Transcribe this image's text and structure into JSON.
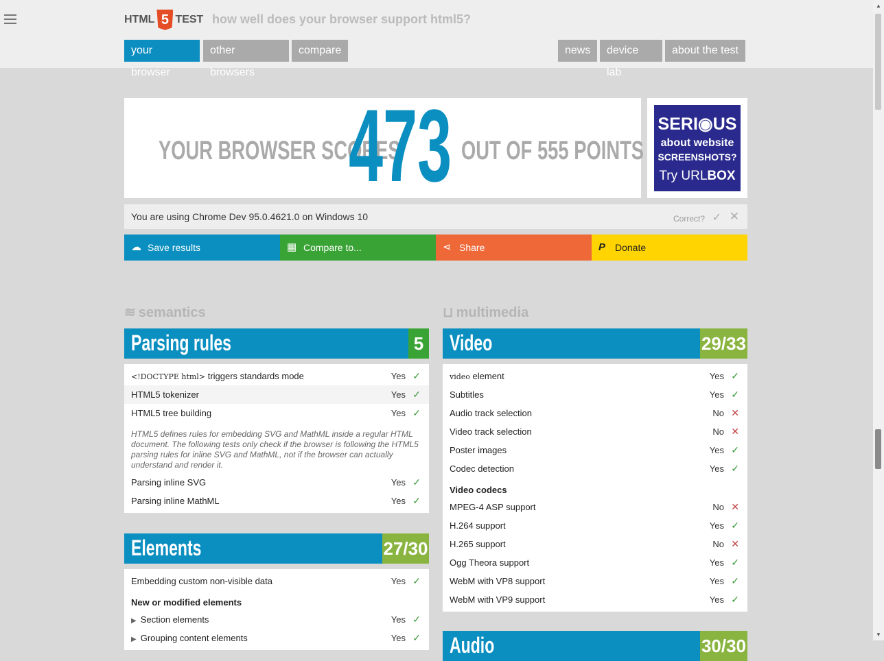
{
  "header": {
    "logo_left": "HTML",
    "logo_shield": "5",
    "logo_right": "TEST",
    "tagline": "how well does your browser support html5?",
    "nav_left": [
      "your browser",
      "other browsers",
      "compare"
    ],
    "nav_right": [
      "news",
      "device lab",
      "about the test"
    ]
  },
  "score": {
    "prefix": "YOUR BROWSER SCORES",
    "value": "473",
    "suffix": "OUT OF 555 POINTS"
  },
  "ad": {
    "line1": "SERI◉US",
    "line2": "about website",
    "line3": "SCREENSHOTS?",
    "line4_a": "Try URL",
    "line4_b": "BOX"
  },
  "browser_info": {
    "text": "You are using Chrome Dev 95.0.4621.0 on Windows 10",
    "correct_label": "Correct?"
  },
  "actions": {
    "save": "Save results",
    "compare": "Compare to...",
    "share": "Share",
    "donate": "Donate"
  },
  "sections": {
    "semantics": "semantics",
    "multimedia": "multimedia"
  },
  "parsing": {
    "title": "Parsing rules",
    "score": "5",
    "row1_code": "<!DOCTYPE html>",
    "row1_text": " triggers standards mode",
    "row2": "HTML5 tokenizer",
    "row3": "HTML5 tree building",
    "note": "HTML5 defines rules for embedding SVG and MathML inside a regular HTML document. The following tests only check if the browser is following the HTML5 parsing rules for inline SVG and MathML, not if the browser can actually understand and render it.",
    "row4": "Parsing inline SVG",
    "row5": "Parsing inline MathML",
    "yes": "Yes",
    "no": "No"
  },
  "elements": {
    "title": "Elements",
    "score": "27/30",
    "row1": "Embedding custom non-visible data",
    "subhead": "New or modified elements",
    "row2": "Section elements",
    "row3": "Grouping content elements"
  },
  "video": {
    "title": "Video",
    "score": "29/33",
    "row1_code": "video",
    "row1_text": " element",
    "row2": "Subtitles",
    "row3": "Audio track selection",
    "row4": "Video track selection",
    "row5": "Poster images",
    "row6": "Codec detection",
    "subhead": "Video codecs",
    "row7": "MPEG-4 ASP support",
    "row8": "H.264 support",
    "row9": "H.265 support",
    "row10": "Ogg Theora support",
    "row11": "WebM with VP8 support",
    "row12": "WebM with VP9 support"
  },
  "audio": {
    "title": "Audio",
    "score": "30/30"
  },
  "colors": {
    "blue": "#0a8fc0",
    "green": "#3aa335",
    "orange": "#ef6838",
    "yellow": "#ffd400",
    "olive": "#8ab440"
  }
}
